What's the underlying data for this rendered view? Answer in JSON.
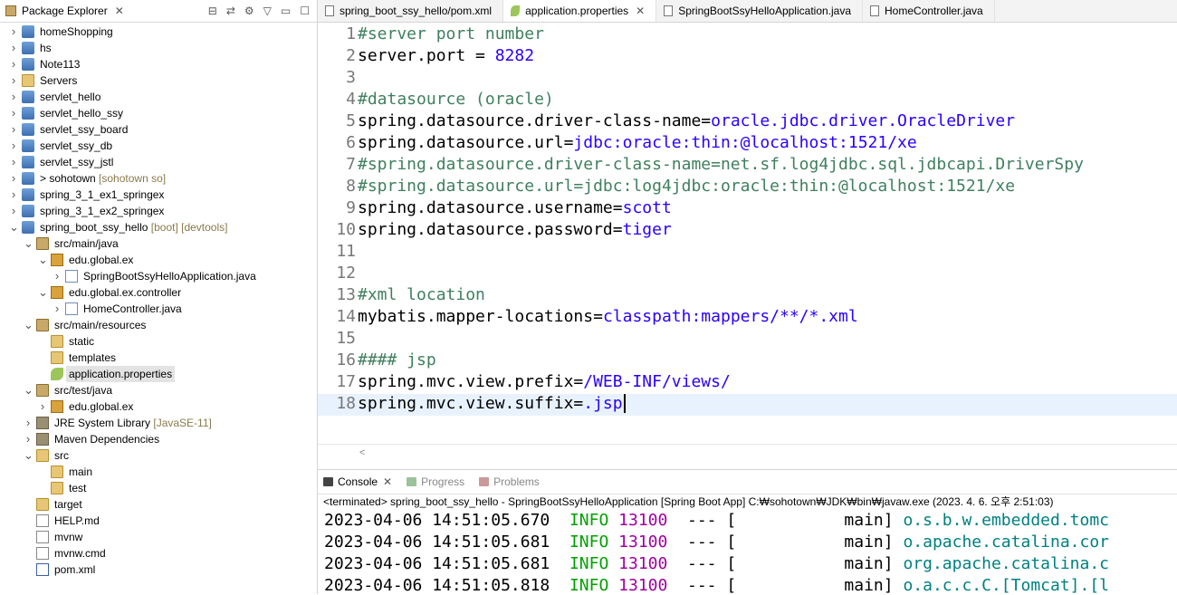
{
  "package_explorer": {
    "title": "Package Explorer",
    "items": [
      {
        "label": "homeShopping",
        "depth": 0,
        "arrow": ">",
        "icon": "project",
        "decor": ""
      },
      {
        "label": "hs",
        "depth": 0,
        "arrow": ">",
        "icon": "project",
        "decor": ""
      },
      {
        "label": "Note113",
        "depth": 0,
        "arrow": ">",
        "icon": "project",
        "decor": ""
      },
      {
        "label": "Servers",
        "depth": 0,
        "arrow": ">",
        "icon": "folder",
        "decor": ""
      },
      {
        "label": "servlet_hello",
        "depth": 0,
        "arrow": ">",
        "icon": "project",
        "decor": ""
      },
      {
        "label": "servlet_hello_ssy",
        "depth": 0,
        "arrow": ">",
        "icon": "project",
        "decor": ""
      },
      {
        "label": "servlet_ssy_board",
        "depth": 0,
        "arrow": ">",
        "icon": "project",
        "decor": ""
      },
      {
        "label": "servlet_ssy_db",
        "depth": 0,
        "arrow": ">",
        "icon": "project",
        "decor": ""
      },
      {
        "label": "servlet_ssy_jstl",
        "depth": 0,
        "arrow": ">",
        "icon": "project",
        "decor": ""
      },
      {
        "label": "> sohotown",
        "depth": 0,
        "arrow": ">",
        "icon": "project",
        "decor": "[sohotown so]"
      },
      {
        "label": "spring_3_1_ex1_springex",
        "depth": 0,
        "arrow": ">",
        "icon": "project",
        "decor": ""
      },
      {
        "label": "spring_3_1_ex2_springex",
        "depth": 0,
        "arrow": ">",
        "icon": "project",
        "decor": ""
      },
      {
        "label": "spring_boot_ssy_hello",
        "depth": 0,
        "arrow": "v",
        "icon": "project",
        "decor": "[boot] [devtools]"
      },
      {
        "label": "src/main/java",
        "depth": 1,
        "arrow": "v",
        "icon": "src",
        "decor": ""
      },
      {
        "label": "edu.global.ex",
        "depth": 2,
        "arrow": "v",
        "icon": "pkg",
        "decor": ""
      },
      {
        "label": "SpringBootSsyHelloApplication.java",
        "depth": 3,
        "arrow": ">",
        "icon": "java",
        "decor": ""
      },
      {
        "label": "edu.global.ex.controller",
        "depth": 2,
        "arrow": "v",
        "icon": "pkg",
        "decor": ""
      },
      {
        "label": "HomeController.java",
        "depth": 3,
        "arrow": ">",
        "icon": "java",
        "decor": ""
      },
      {
        "label": "src/main/resources",
        "depth": 1,
        "arrow": "v",
        "icon": "src",
        "decor": ""
      },
      {
        "label": "static",
        "depth": 2,
        "arrow": "",
        "icon": "folder",
        "decor": ""
      },
      {
        "label": "templates",
        "depth": 2,
        "arrow": "",
        "icon": "folder",
        "decor": ""
      },
      {
        "label": "application.properties",
        "depth": 2,
        "arrow": "",
        "icon": "leaf",
        "decor": "",
        "selected": true
      },
      {
        "label": "src/test/java",
        "depth": 1,
        "arrow": "v",
        "icon": "src",
        "decor": ""
      },
      {
        "label": "edu.global.ex",
        "depth": 2,
        "arrow": ">",
        "icon": "pkg",
        "decor": ""
      },
      {
        "label": "JRE System Library",
        "depth": 1,
        "arrow": ">",
        "icon": "lib",
        "decor": "[JavaSE-11]"
      },
      {
        "label": "Maven Dependencies",
        "depth": 1,
        "arrow": ">",
        "icon": "lib",
        "decor": ""
      },
      {
        "label": "src",
        "depth": 1,
        "arrow": "v",
        "icon": "folder",
        "decor": ""
      },
      {
        "label": "main",
        "depth": 2,
        "arrow": "",
        "icon": "folder",
        "decor": ""
      },
      {
        "label": "test",
        "depth": 2,
        "arrow": "",
        "icon": "folder",
        "decor": ""
      },
      {
        "label": "target",
        "depth": 1,
        "arrow": "",
        "icon": "folder",
        "decor": ""
      },
      {
        "label": "HELP.md",
        "depth": 1,
        "arrow": "",
        "icon": "file",
        "decor": ""
      },
      {
        "label": "mvnw",
        "depth": 1,
        "arrow": "",
        "icon": "file",
        "decor": ""
      },
      {
        "label": "mvnw.cmd",
        "depth": 1,
        "arrow": "",
        "icon": "file",
        "decor": ""
      },
      {
        "label": "pom.xml",
        "depth": 1,
        "arrow": "",
        "icon": "xml",
        "decor": ""
      }
    ]
  },
  "editor": {
    "tabs": [
      {
        "label": "spring_boot_ssy_hello/pom.xml",
        "active": false,
        "icon": "file"
      },
      {
        "label": "application.properties",
        "active": true,
        "icon": "leaf"
      },
      {
        "label": "SpringBootSsyHelloApplication.java",
        "active": false,
        "icon": "java"
      },
      {
        "label": "HomeController.java",
        "active": false,
        "icon": "java"
      }
    ],
    "lines": [
      {
        "n": "1",
        "key": "#server port number",
        "val": "",
        "comment": true
      },
      {
        "n": "2",
        "key": "server.port = ",
        "val": "8282",
        "comment": false
      },
      {
        "n": "3",
        "key": "",
        "val": "",
        "comment": false
      },
      {
        "n": "4",
        "key": "#datasource (oracle)",
        "val": "",
        "comment": true
      },
      {
        "n": "5",
        "key": "spring.datasource.driver-class-name=",
        "val": "oracle.jdbc.driver.OracleDriver",
        "comment": false
      },
      {
        "n": "6",
        "key": "spring.datasource.url=",
        "val": "jdbc:oracle:thin:@localhost:1521/xe",
        "comment": false
      },
      {
        "n": "7",
        "key": "#spring.datasource.driver-class-name=net.sf.log4jdbc.sql.jdbcapi.DriverSpy",
        "val": "",
        "comment": true
      },
      {
        "n": "8",
        "key": "#spring.datasource.url=jdbc:log4jdbc:oracle:thin:@localhost:1521/xe",
        "val": "",
        "comment": true
      },
      {
        "n": "9",
        "key": "spring.datasource.username=",
        "val": "scott",
        "comment": false
      },
      {
        "n": "10",
        "key": "spring.datasource.password=",
        "val": "tiger",
        "comment": false
      },
      {
        "n": "11",
        "key": "",
        "val": "",
        "comment": false
      },
      {
        "n": "12",
        "key": "",
        "val": "",
        "comment": false
      },
      {
        "n": "13",
        "key": "#xml location",
        "val": "",
        "comment": true
      },
      {
        "n": "14",
        "key": "mybatis.mapper-locations=",
        "val": "classpath:mappers/**/*.xml",
        "comment": false
      },
      {
        "n": "15",
        "key": "",
        "val": "",
        "comment": false
      },
      {
        "n": "16",
        "key": "#### jsp",
        "val": "",
        "comment": true
      },
      {
        "n": "17",
        "key": "spring.mvc.view.prefix=",
        "val": "/WEB-INF/views/",
        "comment": false
      },
      {
        "n": "18",
        "key": "spring.mvc.view.suffix=",
        "val": ".jsp",
        "comment": false
      }
    ],
    "scroll_glyph": "<"
  },
  "console": {
    "tabs": [
      {
        "label": "Console",
        "active": true
      },
      {
        "label": "Progress",
        "active": false
      },
      {
        "label": "Problems",
        "active": false
      }
    ],
    "terminated": "<terminated> spring_boot_ssy_hello - SpringBootSsyHelloApplication [Spring Boot App] C:₩sohotown₩JDK₩bin₩javaw.exe (2023. 4. 6. 오후 2:51:03)",
    "logs": [
      {
        "ts": "2023-04-06 14:51:05.670",
        "level": "INFO",
        "pid": "13100",
        "sep": " --- [",
        "thread": "           main]",
        "logger": "o.s.b.w.embedded.tomc"
      },
      {
        "ts": "2023-04-06 14:51:05.681",
        "level": "INFO",
        "pid": "13100",
        "sep": " --- [",
        "thread": "           main]",
        "logger": "o.apache.catalina.cor"
      },
      {
        "ts": "2023-04-06 14:51:05.681",
        "level": "INFO",
        "pid": "13100",
        "sep": " --- [",
        "thread": "           main]",
        "logger": "org.apache.catalina.c"
      },
      {
        "ts": "2023-04-06 14:51:05.818",
        "level": "INFO",
        "pid": "13100",
        "sep": " --- [",
        "thread": "           main]",
        "logger": "o.a.c.c.C.[Tomcat].[l"
      }
    ]
  }
}
